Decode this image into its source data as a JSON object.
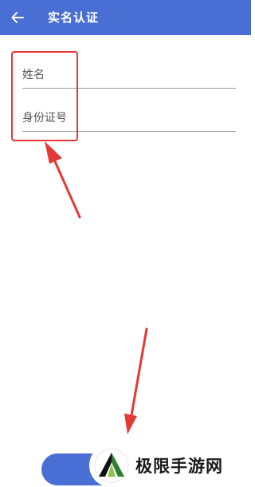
{
  "header": {
    "title": "实名认证",
    "back_icon": "arrow-left-icon",
    "background_color": "#4a6fd4"
  },
  "form": {
    "name_placeholder": "姓名",
    "id_number_placeholder": "身份证号"
  },
  "watermark": {
    "text": "极限手游网"
  },
  "colors": {
    "accent": "#4a6fd4",
    "annotation": "#e53935"
  }
}
